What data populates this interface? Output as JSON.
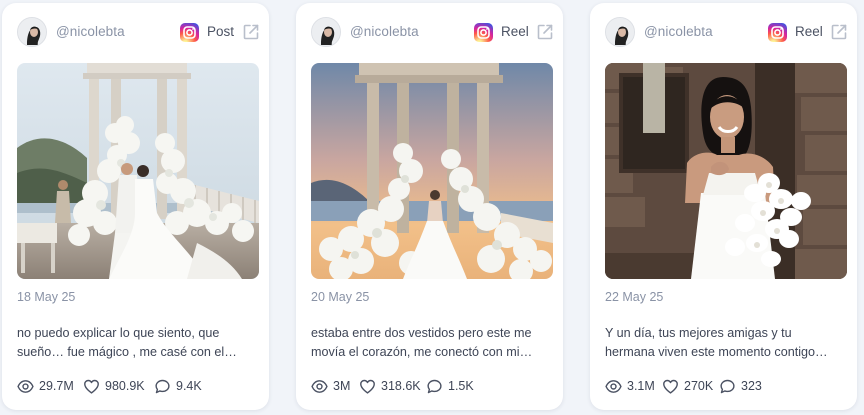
{
  "colors": {
    "page_background": "#f1f4f9",
    "card_background": "#ffffff",
    "muted_text": "#8a93a6",
    "body_text": "#3e4556"
  },
  "cards": [
    {
      "handle": "@nicolebta",
      "platform_icon": "instagram-icon",
      "type": "Post",
      "image_alt": "couple kissing under a white marble gazebo covered in white flowers by the sea",
      "date": "18 May 25",
      "caption_lines": [
        "no puedo explicar lo que siento, que",
        "sueño… fue mágico , me casé con el…"
      ],
      "views": "29.7M",
      "likes": "980.9K",
      "comments": "9.4K"
    },
    {
      "handle": "@nicolebta",
      "platform_icon": "instagram-icon",
      "type": "Reel",
      "image_alt": "bride standing among white flowers beneath a stone gazebo at sunset",
      "date": "20 May 25",
      "caption_lines": [
        "estaba entre dos vestidos pero este me",
        "movía el corazón, me conectó con mi…"
      ],
      "views": "3M",
      "likes": "318.6K",
      "comments": "1.5K"
    },
    {
      "handle": "@nicolebta",
      "platform_icon": "instagram-icon",
      "type": "Reel",
      "image_alt": "smiling bride holding white orchids in front of a stone wall",
      "date": "22 May 25",
      "caption_lines": [
        "Y un día, tus mejores amigas y tu",
        "hermana viven este momento contigo…"
      ],
      "views": "3.1M",
      "likes": "270K",
      "comments": "323"
    }
  ]
}
